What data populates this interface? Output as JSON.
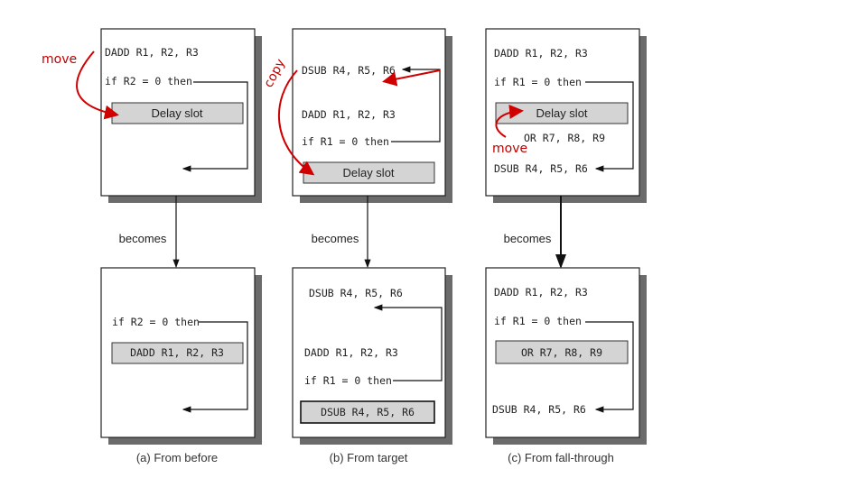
{
  "colors": {
    "annotation": "#c00000",
    "slot_fill": "#d4d4d4",
    "shadow": "#6b6b6b"
  },
  "panels": [
    {
      "top": {
        "lines": [
          "DADD R1, R2, R3",
          "if R2 = 0 then"
        ],
        "slot": "Delay slot"
      },
      "becomes": "becomes",
      "bottom": {
        "lines": [
          "if R2 = 0 then"
        ],
        "slot": "DADD R1, R2, R3"
      },
      "caption": "(a) From before",
      "annotation": "move"
    },
    {
      "top": {
        "lines": [
          "DSUB R4, R5, R6",
          "DADD R1, R2, R3",
          "if R1 = 0 then"
        ],
        "slot": "Delay slot"
      },
      "becomes": "becomes",
      "bottom": {
        "lines": [
          "DSUB R4, R5, R6",
          "DADD R1, R2, R3",
          "if R1 = 0 then"
        ],
        "slot": "DSUB R4, R5, R6"
      },
      "caption": "(b) From target",
      "annotation": "copy"
    },
    {
      "top": {
        "lines": [
          "DADD R1, R2, R3",
          "if R1 = 0 then",
          "OR R7, R8, R9",
          "DSUB R4, R5, R6"
        ],
        "slot": "Delay slot"
      },
      "becomes": "becomes",
      "bottom": {
        "lines": [
          "DADD R1, R2, R3",
          "if R1 = 0 then",
          "DSUB R4, R5, R6"
        ],
        "slot": "OR R7, R8, R9"
      },
      "caption": "(c) From fall-through",
      "annotation": "move"
    }
  ]
}
